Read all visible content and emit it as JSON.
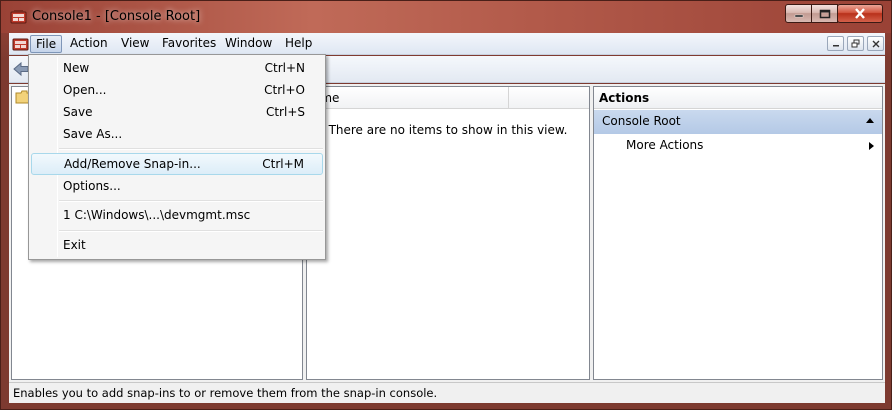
{
  "window": {
    "title": "Console1 - [Console Root]"
  },
  "menubar": {
    "items": [
      {
        "label": "File"
      },
      {
        "label": "Action"
      },
      {
        "label": "View"
      },
      {
        "label": "Favorites"
      },
      {
        "label": "Window"
      },
      {
        "label": "Help"
      }
    ]
  },
  "file_menu": {
    "items": [
      {
        "label": "New",
        "shortcut": "Ctrl+N"
      },
      {
        "label": "Open...",
        "shortcut": "Ctrl+O"
      },
      {
        "label": "Save",
        "shortcut": "Ctrl+S"
      },
      {
        "label": "Save As...",
        "shortcut": ""
      },
      {
        "label": "Add/Remove Snap-in...",
        "shortcut": "Ctrl+M"
      },
      {
        "label": "Options...",
        "shortcut": ""
      },
      {
        "label": "1 C:\\Windows\\...\\devmgmt.msc",
        "shortcut": ""
      },
      {
        "label": "Exit",
        "shortcut": ""
      }
    ],
    "highlighted": "Add/Remove Snap-in..."
  },
  "list_pane": {
    "column_header": "ame",
    "empty_message": "There are no items to show in this view."
  },
  "actions_pane": {
    "header": "Actions",
    "section": "Console Root",
    "item": "More Actions"
  },
  "statusbar": {
    "text": "Enables you to add snap-ins to or remove them from the snap-in console."
  },
  "colors": {
    "title_bar": "#9a4236",
    "menu_highlight_border": "#a8d8eb",
    "actions_section_bg": "#c9d9ee"
  },
  "icons": [
    "console-icon",
    "folder-icon",
    "back-arrow-icon",
    "minimize-icon",
    "maximize-icon",
    "close-icon"
  ]
}
